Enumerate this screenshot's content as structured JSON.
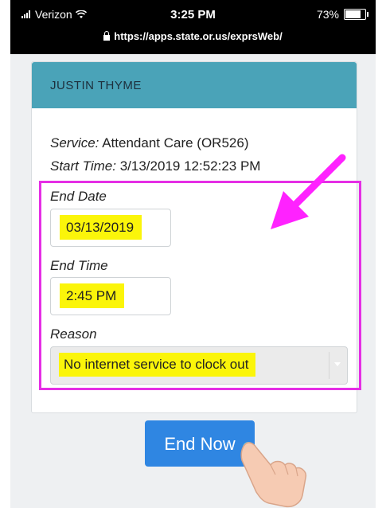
{
  "status_bar": {
    "carrier": "Verizon",
    "time": "3:25 PM",
    "battery": "73%",
    "url": "https://apps.state.or.us/exprsWeb/"
  },
  "card": {
    "header_name": "JUSTIN THYME",
    "service_label": "Service:",
    "service_value": "Attendant Care (OR526)",
    "start_time_label": "Start Time:",
    "start_time_value": "3/13/2019 12:52:23 PM",
    "end_date_label": "End Date",
    "end_date_value": "03/13/2019",
    "end_time_label": "End Time",
    "end_time_value": "2:45 PM",
    "reason_label": "Reason",
    "reason_value": "No internet service to clock out"
  },
  "actions": {
    "end_now_label": "End Now"
  },
  "annotation": {
    "highlight_color": "#e52ee5",
    "field_highlight_color": "#fbf50a"
  }
}
